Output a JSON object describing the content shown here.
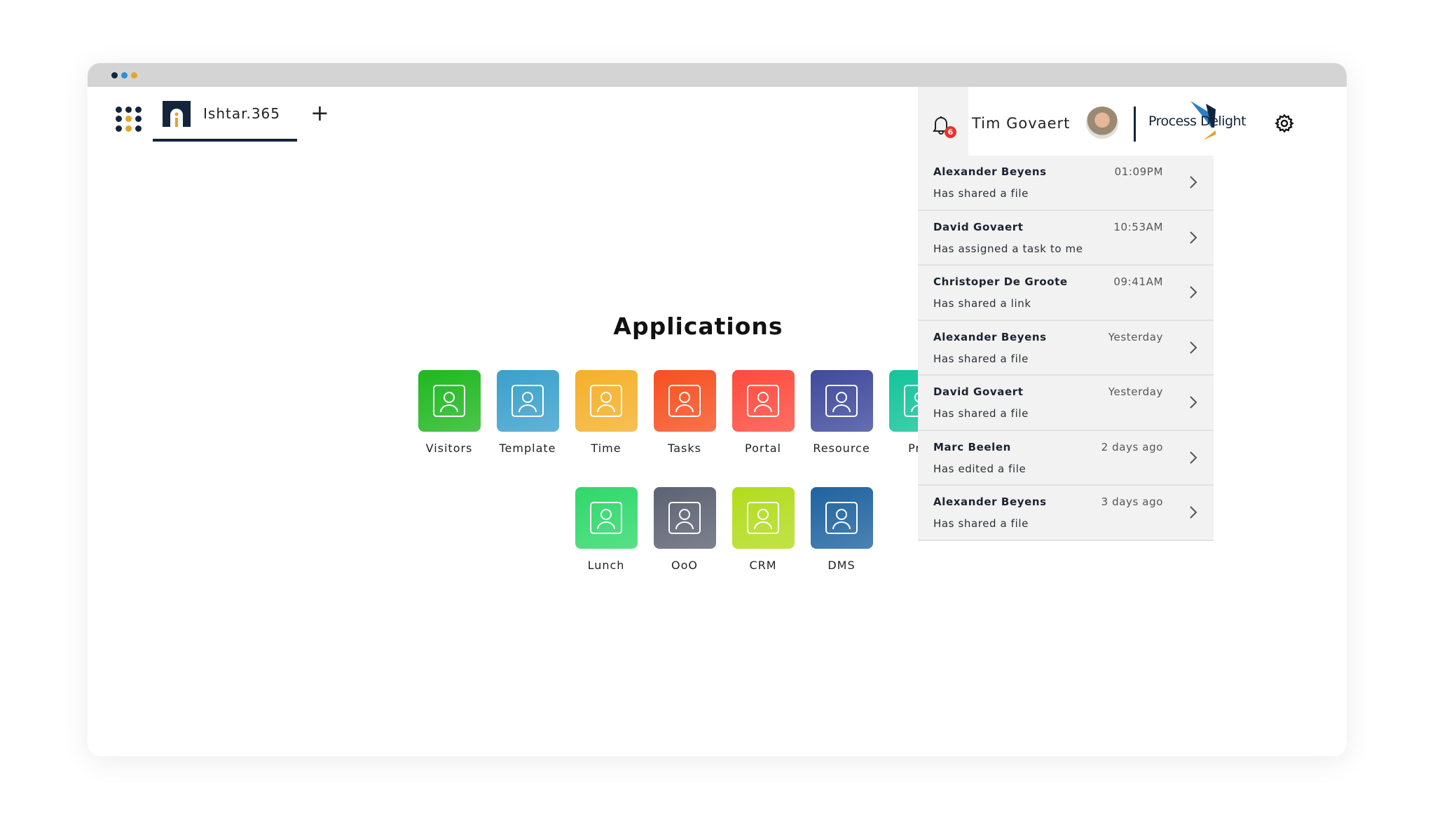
{
  "window": {
    "dots": [
      "#14243b",
      "#2d8fd5",
      "#e0a52a"
    ]
  },
  "header": {
    "tab_label": "Ishtar.365",
    "add_tab_icon": "plus-icon",
    "apps_icon": "grid-icon",
    "notification_count": "6",
    "user_name": "Tim Govaert",
    "brand": "Process Delight",
    "settings_icon": "gear-icon"
  },
  "main": {
    "title": "Applications",
    "apps": [
      {
        "label": "Visitors",
        "color": "#1fb81f"
      },
      {
        "label": "Template",
        "color": "#3aa0cc"
      },
      {
        "label": "Time",
        "color": "#f5b02a"
      },
      {
        "label": "Tasks",
        "color": "#f65020"
      },
      {
        "label": "Portal",
        "color": "#ff4a3d"
      },
      {
        "label": "Resource",
        "color": "#3f4a9c"
      },
      {
        "label": "Proj",
        "color": "#14c49a"
      },
      {
        "label": "Lunch",
        "color": "#2fd86a"
      },
      {
        "label": "OoO",
        "color": "#5d6272"
      },
      {
        "label": "CRM",
        "color": "#b2dc1c"
      },
      {
        "label": "DMS",
        "color": "#1f63a0"
      }
    ]
  },
  "notifications": [
    {
      "name": "Alexander Beyens",
      "time": "01:09PM",
      "message": "Has shared a file"
    },
    {
      "name": "David Govaert",
      "time": "10:53AM",
      "message": "Has assigned a task to me"
    },
    {
      "name": "Christoper De Groote",
      "time": "09:41AM",
      "message": "Has shared a link"
    },
    {
      "name": "Alexander Beyens",
      "time": "Yesterday",
      "message": "Has shared a file"
    },
    {
      "name": "David Govaert",
      "time": "Yesterday",
      "message": "Has shared a file"
    },
    {
      "name": "Marc Beelen",
      "time": "2 days ago",
      "message": "Has edited a file"
    },
    {
      "name": "Alexander Beyens",
      "time": "3 days ago",
      "message": "Has shared a file"
    }
  ]
}
